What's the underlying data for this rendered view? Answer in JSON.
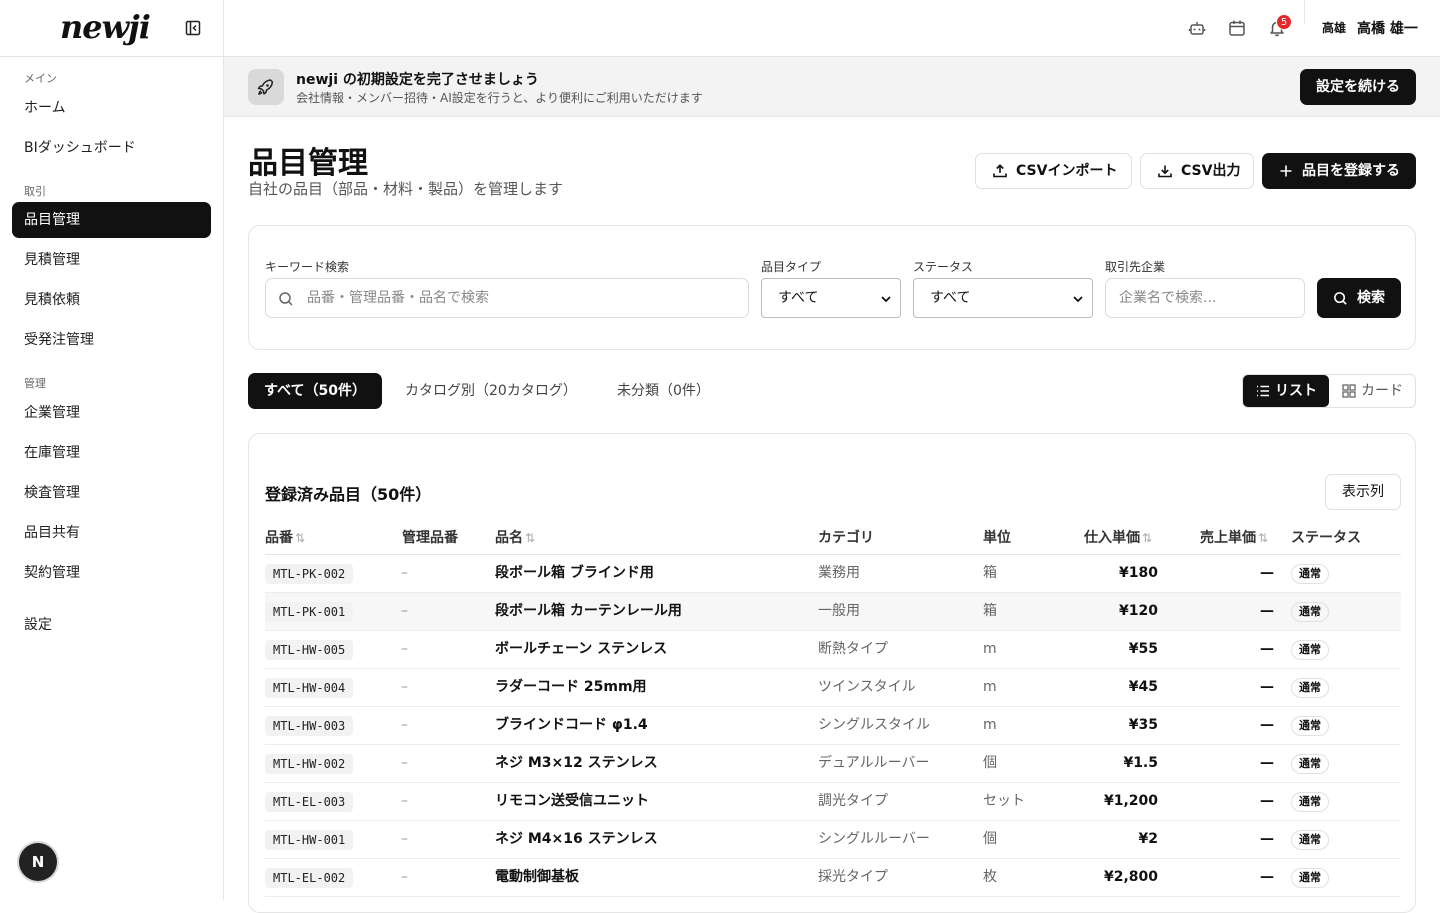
{
  "app": {
    "logo": "newji"
  },
  "sidebar": {
    "sections": [
      {
        "label": "メイン",
        "items": [
          "ホーム",
          "BIダッシュボード"
        ]
      },
      {
        "label": "取引",
        "items": [
          "品目管理",
          "見積管理",
          "見積依頼",
          "受発注管理"
        ]
      },
      {
        "label": "管理",
        "items": [
          "企業管理",
          "在庫管理",
          "検査管理",
          "品目共有",
          "契約管理"
        ]
      }
    ],
    "settings": "設定",
    "avatar_letter": "N"
  },
  "header": {
    "notification_count": "5",
    "user_first": "高雄",
    "user_name": "高橋 雄一"
  },
  "banner": {
    "title": "newji の初期設定を完了させましょう",
    "subtitle": "会社情報・メンバー招待・AI設定を行うと、より便利にご利用いただけます",
    "button": "設定を続ける"
  },
  "page": {
    "title": "品目管理",
    "subtitle": "自社の品目（部品・材料・製品）を管理します",
    "csv_import": "CSVインポート",
    "csv_export": "CSV出力",
    "register": "品目を登録する"
  },
  "filters": {
    "keyword_label": "キーワード検索",
    "keyword_placeholder": "品番・管理品番・品名で検索",
    "type_label": "品目タイプ",
    "type_value": "すべて",
    "status_label": "ステータス",
    "status_value": "すべて",
    "partner_label": "取引先企業",
    "partner_placeholder": "企業名で検索...",
    "search_button": "検索"
  },
  "tabs": {
    "all": "すべて（50件）",
    "by_catalog": "カタログ別（20カタログ）",
    "unclassified": "未分類（0件）"
  },
  "view": {
    "list": "リスト",
    "card": "カード"
  },
  "table": {
    "title": "登録済み品目（50件）",
    "columns_button": "表示列",
    "headers": {
      "code": "品番",
      "mgmt": "管理品番",
      "name": "品名",
      "category": "カテゴリ",
      "unit": "単位",
      "buy": "仕入単価",
      "sell": "売上単価",
      "status": "ステータス"
    },
    "rows": [
      {
        "code": "MTL-PK-002",
        "mgmt": "–",
        "name": "段ボール箱 ブラインド用",
        "category": "業務用",
        "unit": "箱",
        "buy": "¥180",
        "sell": "—",
        "status": "通常"
      },
      {
        "code": "MTL-PK-001",
        "mgmt": "–",
        "name": "段ボール箱 カーテンレール用",
        "category": "一般用",
        "unit": "箱",
        "buy": "¥120",
        "sell": "—",
        "status": "通常"
      },
      {
        "code": "MTL-HW-005",
        "mgmt": "–",
        "name": "ボールチェーン ステンレス",
        "category": "断熱タイプ",
        "unit": "m",
        "buy": "¥55",
        "sell": "—",
        "status": "通常"
      },
      {
        "code": "MTL-HW-004",
        "mgmt": "–",
        "name": "ラダーコード 25mm用",
        "category": "ツインスタイル",
        "unit": "m",
        "buy": "¥45",
        "sell": "—",
        "status": "通常"
      },
      {
        "code": "MTL-HW-003",
        "mgmt": "–",
        "name": "ブラインドコード φ1.4",
        "category": "シングルスタイル",
        "unit": "m",
        "buy": "¥35",
        "sell": "—",
        "status": "通常"
      },
      {
        "code": "MTL-HW-002",
        "mgmt": "–",
        "name": "ネジ M3×12 ステンレス",
        "category": "デュアルルーバー",
        "unit": "個",
        "buy": "¥1.5",
        "sell": "—",
        "status": "通常"
      },
      {
        "code": "MTL-EL-003",
        "mgmt": "–",
        "name": "リモコン送受信ユニット",
        "category": "調光タイプ",
        "unit": "セット",
        "buy": "¥1,200",
        "sell": "—",
        "status": "通常"
      },
      {
        "code": "MTL-HW-001",
        "mgmt": "–",
        "name": "ネジ M4×16 ステンレス",
        "category": "シングルルーバー",
        "unit": "個",
        "buy": "¥2",
        "sell": "—",
        "status": "通常"
      },
      {
        "code": "MTL-EL-002",
        "mgmt": "–",
        "name": "電動制御基板",
        "category": "採光タイプ",
        "unit": "枚",
        "buy": "¥2,800",
        "sell": "—",
        "status": "通常"
      }
    ]
  }
}
